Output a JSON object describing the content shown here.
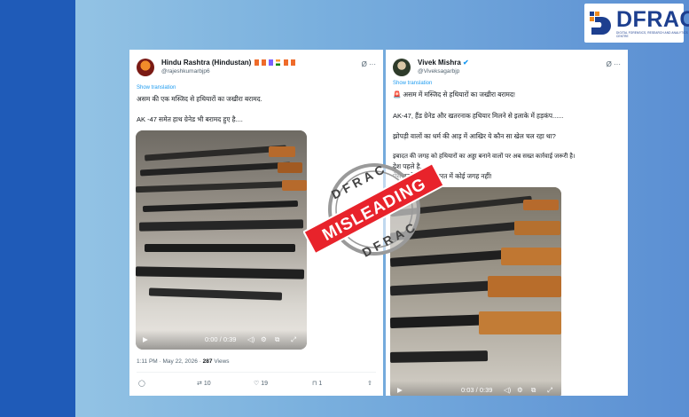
{
  "brand": {
    "logo_text": "DFRAC",
    "logo_sub": "DIGITAL FORENSICS, RESEARCH AND ANALYTICS CENTRE"
  },
  "left_post": {
    "display_name": "Hindu Rashtra (Hindustan)",
    "handle": "@rajeshkumarbjp6",
    "more": "Ø ···",
    "show_translation": "Show translation",
    "text_lines": [
      "असम की एक मस्जिद से हथियारों का जखीरा बरामद.",
      "AK -47 समेत हाथ ग्रेनेड भी बरामद हुए है...."
    ],
    "video_time": "0:00 / 0:39",
    "timestamp": "1:11 PM · May 22, 2026 · ",
    "views": "287",
    "views_label": " Views",
    "reposts": "10",
    "likes": "19",
    "bookmarks": "1"
  },
  "right_post": {
    "display_name": "Vivek Mishra",
    "handle": "@Viveksagarbjp",
    "more": "Ø ···",
    "show_translation": "Show translation",
    "text_lines": [
      "🚨 असम में मस्जिद से हथियारों का जखीरा बरामद!",
      "AK-47, हैंड ग्रेनेड और खतरनाक हथियार मिलने से इलाके में हड़कंप......",
      "झोपड़ी वालों का धर्म की आड़ में आखिर ये कौन सा खेल चल रहा था?",
      "इबादत की जगह को हथियारों का अड्डा बनाने वालों पर अब सख्त कार्रवाई जरूरी है।",
      "देश पहले है...",
      "ऐसे तत्वों के लिए भारत में कोई जगह नहीं!"
    ],
    "video_time": "0:03 / 0:39"
  },
  "stamp": {
    "top": "DFRAC",
    "banner": "MISLEADING",
    "bottom": "DFRAC"
  },
  "colors": {
    "stamp_red": "#e8232b",
    "brand_blue": "#1d3f8f",
    "link_blue": "#1d9bf0"
  }
}
